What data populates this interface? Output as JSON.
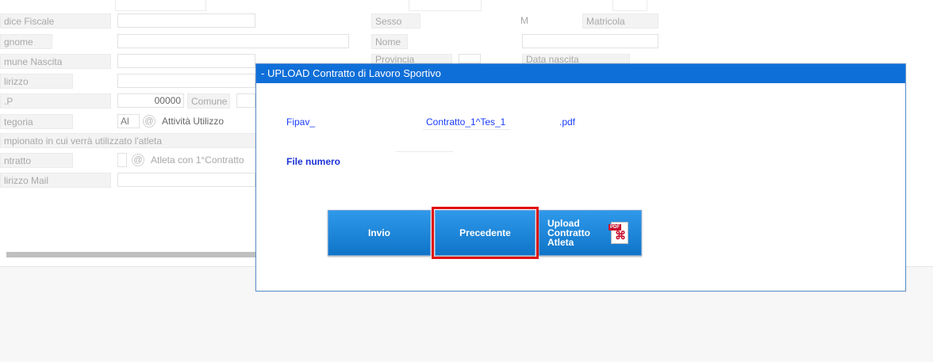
{
  "form": {
    "codice_fiscale_label": "dice Fiscale",
    "cognome_label": "gnome",
    "comune_nascita_label": "mune Nascita",
    "indirizzo_label": "lirizzo",
    "cap_label": ".P",
    "cap_value": "00000",
    "comune_label": "Comune",
    "categoria_label": "tegoria",
    "categoria_value": "Al",
    "attivita_label": "Attività Utilizzo",
    "campionato_label": "mpionato in cui verrà utilizzato l'atleta",
    "contratto_label": "ntratto",
    "atleta_contratto_label": "Atleta con 1°Contratto",
    "indirizzo_mail_label": "lirizzo Mail",
    "sesso_label": "Sesso",
    "sesso_value": "M",
    "matricola_label": "Matricola",
    "nome_label": "Nome",
    "provincia_label": "Provincia",
    "data_nascita_label": "Data nascita"
  },
  "dialog": {
    "title": "- UPLOAD Contratto di Lavoro Sportivo",
    "prefix": "Fipav_",
    "middle": "Contratto_1^Tes_1",
    "extension": ".pdf",
    "file_numero_label": "File numero",
    "buttons": {
      "invio": "Invio",
      "precedente": "Precedente",
      "upload_line1": "Upload",
      "upload_line2": "Contratto",
      "upload_line3": "Atleta",
      "pdf_tag": "PDF"
    }
  }
}
